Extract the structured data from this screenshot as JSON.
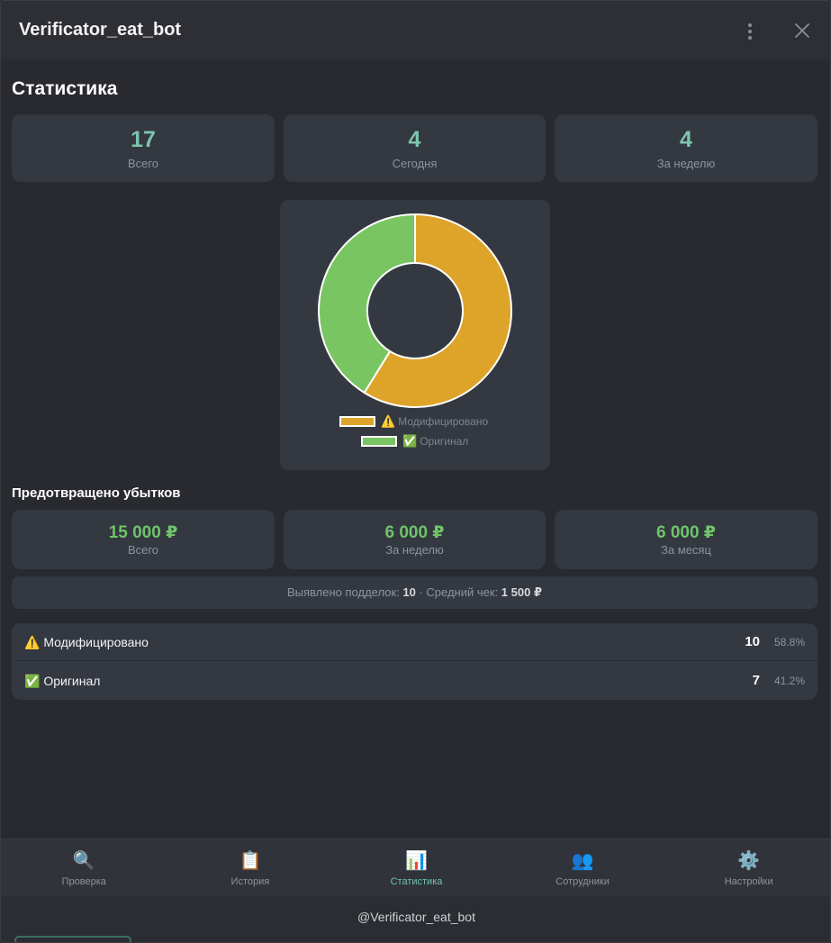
{
  "window": {
    "title": "Verificator_eat_bot"
  },
  "stats": {
    "title": "Статистика",
    "cards": [
      {
        "value": "17",
        "label": "Всего"
      },
      {
        "value": "4",
        "label": "Сегодня"
      },
      {
        "value": "4",
        "label": "За неделю"
      }
    ]
  },
  "chart_data": {
    "type": "pie",
    "donut": true,
    "categories": [
      "⚠️ Модифицировано",
      "✅ Оригинал"
    ],
    "values": [
      10,
      7
    ],
    "colors": [
      "#dea42a",
      "#79c562"
    ],
    "legend": "bottom",
    "title": "",
    "legend_entries": [
      {
        "emoji": "⚠️",
        "text": "Модифицировано"
      },
      {
        "emoji": "✅",
        "text": "Оригинал"
      }
    ]
  },
  "losses": {
    "title": "Предотвращено убытков",
    "cards": [
      {
        "value": "15 000 ₽",
        "label": "Всего"
      },
      {
        "value": "6 000 ₽",
        "label": "За неделю"
      },
      {
        "value": "6 000 ₽",
        "label": "За месяц"
      }
    ],
    "info": {
      "fakes_label": "Выявлено подделок:",
      "fakes_value": "10",
      "separator": "·",
      "avg_label": "Средний чек:",
      "avg_value": "1 500 ₽"
    }
  },
  "breakdown": [
    {
      "emoji": "⚠️",
      "label": "Модифицировано",
      "count": "10",
      "pct": "58.8%"
    },
    {
      "emoji": "✅",
      "label": "Оригинал",
      "count": "7",
      "pct": "41.2%"
    }
  ],
  "nav": [
    {
      "icon": "🔍",
      "icon_name": "magnifier-icon",
      "label": "Проверка",
      "active": false
    },
    {
      "icon": "📋",
      "icon_name": "clipboard-icon",
      "label": "История",
      "active": false
    },
    {
      "icon": "📊",
      "icon_name": "bar-chart-icon",
      "label": "Статистика",
      "active": true
    },
    {
      "icon": "👥",
      "icon_name": "people-icon",
      "label": "Сотрудники",
      "active": false
    },
    {
      "icon": "⚙️",
      "icon_name": "gear-icon",
      "label": "Настройки",
      "active": false
    }
  ],
  "footer": {
    "handle": "@Verificator_eat_bot"
  },
  "colors": {
    "accent_teal": "#7cc5ae",
    "money_green": "#6fc46a",
    "modified": "#dea42a",
    "original": "#79c562"
  }
}
